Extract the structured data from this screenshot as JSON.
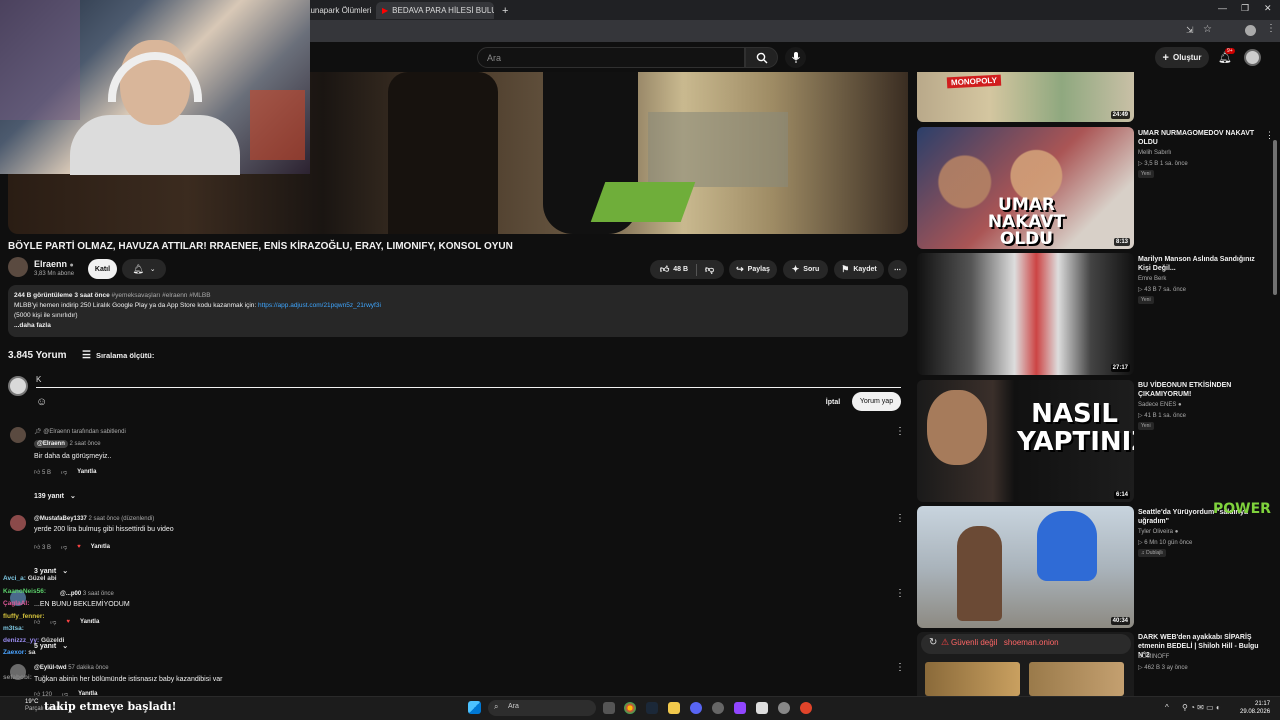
{
  "browser": {
    "tabs": [
      {
        "label": "Lunapark Ölümleri"
      },
      {
        "label": "BEDAVA PARA HİLESİ BULUP M"
      }
    ],
    "new_tab": "+"
  },
  "header": {
    "search_placeholder": "Ara",
    "create_label": "Oluştur",
    "notif_count": "9+"
  },
  "video": {
    "title": "BÖYLE PARTİ OLMAZ, HAVUZA ATTILAR! RRAENEE, ENİS KİRAZOĞLU, ERAY, LIMONIFY, KONSOL OYUN",
    "channel": "Elraenn",
    "subs": "3,83 Mn abone",
    "join_label": "Katıl",
    "likes": "48 B",
    "share_label": "Paylaş",
    "ask_label": "Soru",
    "save_label": "Kaydet"
  },
  "description": {
    "meta": "244 B görüntüleme  3 saat önce",
    "tags": "#yemeksavaşları #elraenn #MLBB",
    "line1": "MLBB'yi hemen indirip 250 Liralık Google Play ya da App Store kodu kazanmak için:",
    "link": "https://app.adjust.com/21pqwn5z_21rwyf3i",
    "line2": "(5000 kişi ile sınırlıdır)",
    "more": "...daha fazla"
  },
  "comments": {
    "count": "3.845 Yorum",
    "sort_label": "Sıralama ölçütü:",
    "input_value": "K",
    "cancel_label": "İptal",
    "post_label": "Yorum yap",
    "reply_label": "Yanıtla",
    "items": [
      {
        "pinned": "@Elraenn tarafından sabitlendi",
        "author": "@Elraenn",
        "time": "2 saat önce",
        "text": "Bir daha da görüşmeyiz..",
        "likes": "5 B",
        "replies": "139 yanıt"
      },
      {
        "author": "@MustafaBey1337",
        "time": "2 saat önce (düzenlendi)",
        "text": "yerde 200 lira bulmuş gibi hissettirdi bu video",
        "likes": "3 B",
        "replies": "3 yanıt"
      },
      {
        "author": "@...p00",
        "time": "3 saat önce",
        "text": "...EN BUNU BEKLEMİYODUM",
        "likes": "",
        "replies": "5 yanıt"
      },
      {
        "author": "@Eylül-twd",
        "time": "57 dakika önce",
        "text": "Tuğkan abinin her bölümünde istisnasız baby kazandibisi var",
        "likes": "120"
      }
    ]
  },
  "sidebar": {
    "videos": [
      {
        "duration": "24:49",
        "thumb_text": "MONOPOLY"
      },
      {
        "title": "UMAR NURMAGOMEDOV NAKAVT OLDU",
        "channel": "Melih Sabırlı",
        "meta": "3,5 B  1 sa. önce",
        "badge": "Yeni",
        "duration": "8:13",
        "thumb_text": "UMAR NAKAVT OLDU"
      },
      {
        "title": "Marilyn Manson Aslında Sandığınız Kişi Değil...",
        "channel": "Emre Berk",
        "meta": "43 B  7 sa. önce",
        "badge": "Yeni",
        "duration": "27:17"
      },
      {
        "title": "BU VİDEONUN ETKİSİNDEN ÇIKAMIYORUM!",
        "channel": "Sadece ENES",
        "meta": "41 B  1 sa. önce",
        "badge": "Yeni",
        "duration": "6:14",
        "thumb_text": "NASIL YAPTINIZ?"
      },
      {
        "title": "Seattle'da Yürüyordum \"saldırıya uğradım\"",
        "channel": "Tyler Oliveira",
        "meta": "6 Mn  10 gün önce",
        "badge": "Dublajlı",
        "duration": "40:34"
      },
      {
        "title": "DARK WEB'den ayakkabı SİPARİŞ etmenin BEDELİ | Shiloh Hill - Bulgu N°2",
        "channel": "BUMINOFF",
        "meta": "462 B  3 ay önce",
        "thumb_text": "Güvenli değil   shoeman.onion"
      }
    ]
  },
  "overlay": {
    "power_text": "POWER",
    "follow_text": "takip etmeye başladı!",
    "chat": [
      {
        "user": "Avci_a:",
        "msg": "Güzel abi"
      },
      {
        "user": "KaanoNeis56:",
        "msg": ""
      },
      {
        "user": "ÇaglaAI:",
        "msg": ""
      },
      {
        "user": "fluffy_fenner:",
        "msg": ""
      },
      {
        "user": "m3tsa:",
        "msg": ""
      },
      {
        "user": "denizzz_yy:",
        "msg": "Güzeldi"
      },
      {
        "user": "Zaexor:",
        "msg": "sa"
      },
      {
        "user": "sefabobi:",
        "msg": ""
      }
    ]
  },
  "taskbar": {
    "weather_temp": "19°C",
    "weather_text": "Parçalı bulutlu",
    "search_label": "Ara",
    "time": "21:17",
    "date": "29.08.2026"
  }
}
